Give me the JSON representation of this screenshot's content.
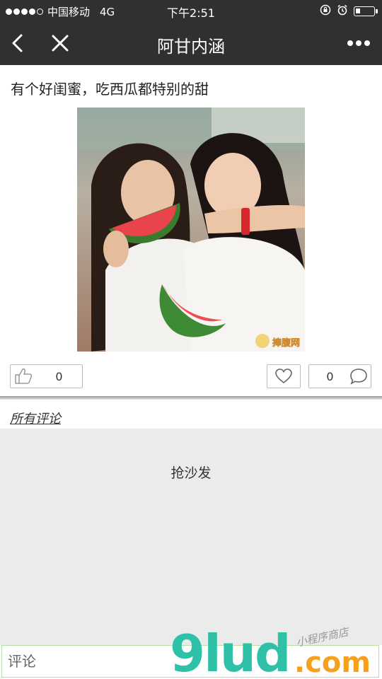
{
  "status_bar": {
    "carrier": "中国移动",
    "network": "4G",
    "time": "下午2:51"
  },
  "nav": {
    "title": "阿甘内涵",
    "back_icon": "chevron-left-icon",
    "close_icon": "close-icon",
    "more_icon": "more-dots-icon"
  },
  "post": {
    "title": "有个好闺蜜，吃西瓜都特别的甜",
    "image_watermark": "捧腹网",
    "like_count": "0",
    "comment_count": "0"
  },
  "comments": {
    "header": "所有评论",
    "empty_text": "抢沙发"
  },
  "input": {
    "placeholder": "评论"
  },
  "watermark": {
    "main": "9lud",
    "tld": ".com",
    "tagline": "小程序商店"
  },
  "colors": {
    "bar_background": "#2e3032",
    "comments_background": "#ebebeb",
    "input_border": "#b6e0a6",
    "watermark_teal": "#2fc1a8",
    "watermark_orange": "#f6a11d"
  }
}
